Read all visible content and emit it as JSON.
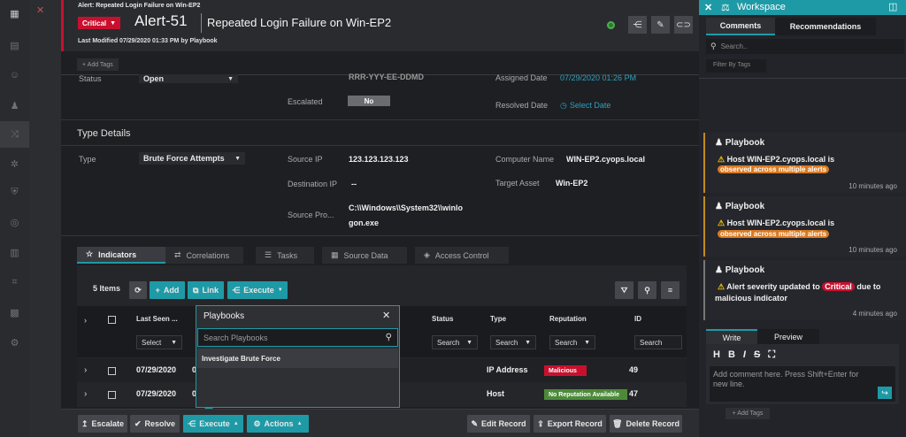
{
  "nav": {
    "icons": [
      "grid-icon",
      "dashboard-icon",
      "people-icon",
      "shuffle-icon",
      "gear-icon",
      "hub-icon",
      "shield-icon",
      "target-icon",
      "book-icon",
      "chart-icon",
      "apps-icon",
      "settings-icon"
    ]
  },
  "header": {
    "breadcrumb": "Alert: Repeated Login Failure on Win-EP2",
    "severity": "Critical",
    "alert_id": "Alert-51",
    "alert_title": "Repeated Login Failure on Win-EP2",
    "last_modified": "Last Modified 07/29/2020 01:33 PM by Playbook"
  },
  "tags": {
    "add_label": "+ Add Tags"
  },
  "fields": {
    "status_label": "Status",
    "status_value": "Open",
    "source_id_label": "Source ID",
    "source_id_value": "RRR-YYY-EE-DDMD",
    "escalated_label": "Escalated",
    "escalated_value": "No",
    "assigned_date_label": "Assigned Date",
    "assigned_date_value": "07/29/2020 01:26 PM",
    "resolved_date_label": "Resolved Date",
    "resolved_date_value": "Select Date"
  },
  "type_details": {
    "heading": "Type Details",
    "type_label": "Type",
    "type_value": "Brute Force Attempts",
    "source_ip_label": "Source IP",
    "source_ip_value": "123.123.123.123",
    "computer_label": "Computer Name",
    "computer_value": "WIN-EP2.cyops.local",
    "dest_ip_label": "Destination IP",
    "dest_ip_value": "--",
    "target_asset_label": "Target Asset",
    "target_asset_value": "Win-EP2",
    "source_proc_label": "Source Pro...",
    "source_proc_line1": "C:\\\\Windows\\\\System32\\\\winlo",
    "source_proc_line2": "gon.exe"
  },
  "tabs": [
    "Indicators",
    "Correlations",
    "Tasks",
    "Source Data",
    "Access Control"
  ],
  "toolbar": {
    "count": "5 Items",
    "add": "Add",
    "link": "Link",
    "execute": "Execute"
  },
  "table": {
    "headers": [
      "Last Seen ...",
      "Status",
      "Type",
      "Reputation",
      "ID"
    ],
    "filters": {
      "select": "Select",
      "search": "Search"
    },
    "rows": [
      {
        "date": "07/29/2020",
        "prefix": "0",
        "type": "IP Address",
        "reputation": "Malicious",
        "rep_color": "#c8102e",
        "id": "49"
      },
      {
        "date": "07/29/2020",
        "prefix": "0",
        "type": "Host",
        "reputation": "No Reputation Available",
        "rep_color": "#4c8a3a",
        "id": "47"
      }
    ]
  },
  "playbooks": {
    "title": "Playbooks",
    "search_placeholder": "Search Playbooks",
    "item": "Investigate Brute Force"
  },
  "footer": {
    "escalate": "Escalate",
    "resolve": "Resolve",
    "execute": "Execute",
    "actions": "Actions",
    "edit": "Edit Record",
    "export": "Export Record",
    "delete": "Delete Record"
  },
  "workspace": {
    "title": "Workspace",
    "tab_comments": "Comments",
    "tab_recommendations": "Recommendations",
    "search_placeholder": "Search..",
    "filter_placeholder": "Filter By Tags",
    "cards": [
      {
        "author": "Playbook",
        "text_before": "Host WIN-EP2.cyops.local is",
        "highlight": "observed across multiple alerts",
        "text_after": "",
        "time": "10 minutes ago"
      },
      {
        "author": "Playbook",
        "text_before": "Host WIN-EP2.cyops.local is",
        "highlight": "observed across multiple alerts",
        "text_after": "",
        "time": "10 minutes ago"
      },
      {
        "author": "Playbook",
        "text_before": "Alert severity updated to",
        "highlight": "Critical",
        "text_after": "due to",
        "text_line2": "malicious indicator",
        "time": "4 minutes ago"
      }
    ],
    "write_tab": "Write",
    "preview_tab": "Preview",
    "comment_placeholder": "Add comment here. Press Shift+Enter for new line.",
    "add_tags": "+ Add Tags"
  }
}
